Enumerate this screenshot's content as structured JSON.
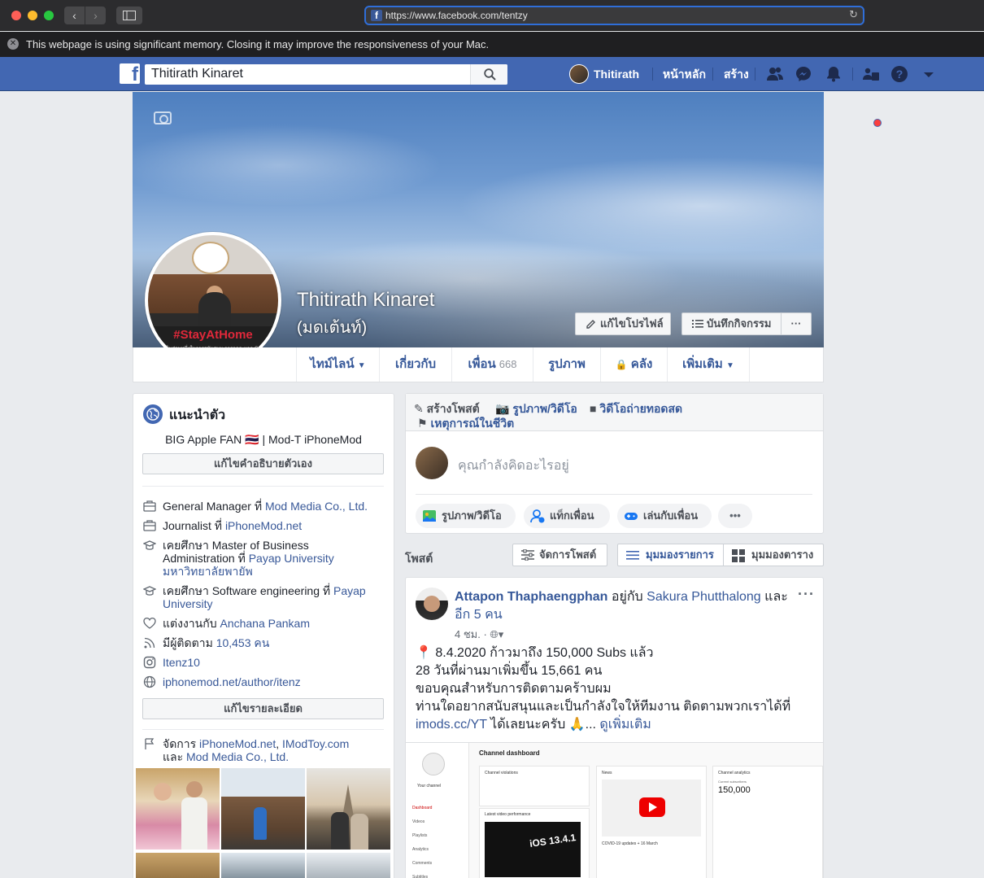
{
  "browser": {
    "url": "https://www.facebook.com/tentzy",
    "memory_warning": "This webpage is using significant memory. Closing it may improve the responsiveness of your Mac."
  },
  "topbar": {
    "search_value": "Thitirath Kinaret",
    "user_name": "Thitirath",
    "home": "หน้าหลัก",
    "create": "สร้าง",
    "brand_color": "#4267b2"
  },
  "profile": {
    "name": "Thitirath Kinaret",
    "alt_name": "(มดเต้นท์)",
    "edit_profile": "แก้ไขโปรไฟล์",
    "activity_log": "บันทึกกิจกรรม",
    "more": "···",
    "avatar_banner": "#StayAtHome",
    "avatar_banner_sub": "ขอร่วมเป็นส่วนหนึ่งในการสนับสนุน การลดระบาด COVID-19"
  },
  "tabs": [
    {
      "label": "ไทม์ไลน์"
    },
    {
      "label": "เกี่ยวกับ"
    },
    {
      "label": "เพื่อน",
      "count": "668"
    },
    {
      "label": "รูปภาพ"
    },
    {
      "label": "คลัง"
    },
    {
      "label": "เพิ่มเติม"
    }
  ],
  "intro": {
    "title": "แนะนำตัว",
    "bio": "BIG  Apple FAN 🇹🇭 | Mod-T iPhoneMod",
    "edit_bio": "แก้ไขคำอธิบายตัวเอง",
    "work1_prefix": "General Manager ที่ ",
    "work1_link": "Mod Media Co., Ltd.",
    "work2_prefix": "Journalist ที่ ",
    "work2_link": "iPhoneMod.net",
    "edu1_prefix": "เคยศึกษา Master of Business Administration ที่ ",
    "edu1_link": "Payap University",
    "edu1_link2": "มหาวิทยาลัยพายัพ",
    "edu2_prefix": "เคยศึกษา Software engineering ที่ ",
    "edu2_link": "Payap University",
    "married_prefix": "แต่งงานกับ ",
    "married_link": "Anchana Pankam",
    "followers_prefix": "มีผู้ติดตาม ",
    "followers_link": "10,453 คน",
    "instagram": "Itenz10",
    "website": "iphonemod.net/author/itenz",
    "edit_details": "แก้ไขรายละเอียด",
    "manage_prefix": "จัดการ ",
    "manage_link1": "iPhoneMod.net",
    "manage_comma": ", ",
    "manage_link2": "IModToy.com",
    "manage_and": "และ ",
    "manage_link3": "Mod Media Co., Ltd."
  },
  "composer": {
    "create_post": "สร้างโพสต์",
    "photo_video": "รูปภาพ/วิดีโอ",
    "live_video": "วิดีโอถ่ายทอดสด",
    "life_event": "เหตุการณ์ในชีวิต",
    "placeholder": "คุณกำลังคิดอะไรอยู่",
    "pill_photo": "รูปภาพ/วิดีโอ",
    "pill_tag": "แท็กเพื่อน",
    "pill_play": "เล่นกับเพื่อน",
    "pill_more": "•••"
  },
  "posts_header": {
    "label": "โพสต์",
    "manage": "จัดการโพสต์",
    "list_view": "มุมมองรายการ",
    "grid_view": "มุมมองตาราง"
  },
  "post": {
    "author": "Attapon Thaphaengphan",
    "with": " อยู่กับ ",
    "tagged": "Sakura Phutthalong",
    "and": " และ ",
    "others": "อีก 5 คน",
    "time": "4 ชม. · ",
    "line1": "📍 8.4.2020 ก้าวมาถึง 150,000 Subs แล้ว",
    "line2": "28 วันที่ผ่านมาเพิ่มขึ้น 15,661 คน",
    "line3": "ขอบคุณสำหรับการติดตามคร้าบผม",
    "line4": "ท่านใดอยากสนับสนุนและเป็นกำลังใจให้ทีมงาน ติดตามพวกเราได้ที่",
    "line5_link": "imods.cc/YT",
    "line5_text": " ได้เลยนะครับ 🙏... ",
    "see_more": "ดูเพิ่มเติม",
    "img_dashboard": "Channel dashboard",
    "img_violations": "Channel violations",
    "img_news": "News",
    "img_analytics": "Channel analytics",
    "img_subs_label": "Current subscribers",
    "img_subs": "150,000",
    "img_latest": "Latest video performance",
    "img_ios": "iOS 13.4.1",
    "img_covid": "COVID-19 updates + 16 March",
    "img_your_channel": "Your channel",
    "img_nav": [
      "Dashboard",
      "Videos",
      "Playlists",
      "Analytics",
      "Comments",
      "Subtitles"
    ]
  }
}
